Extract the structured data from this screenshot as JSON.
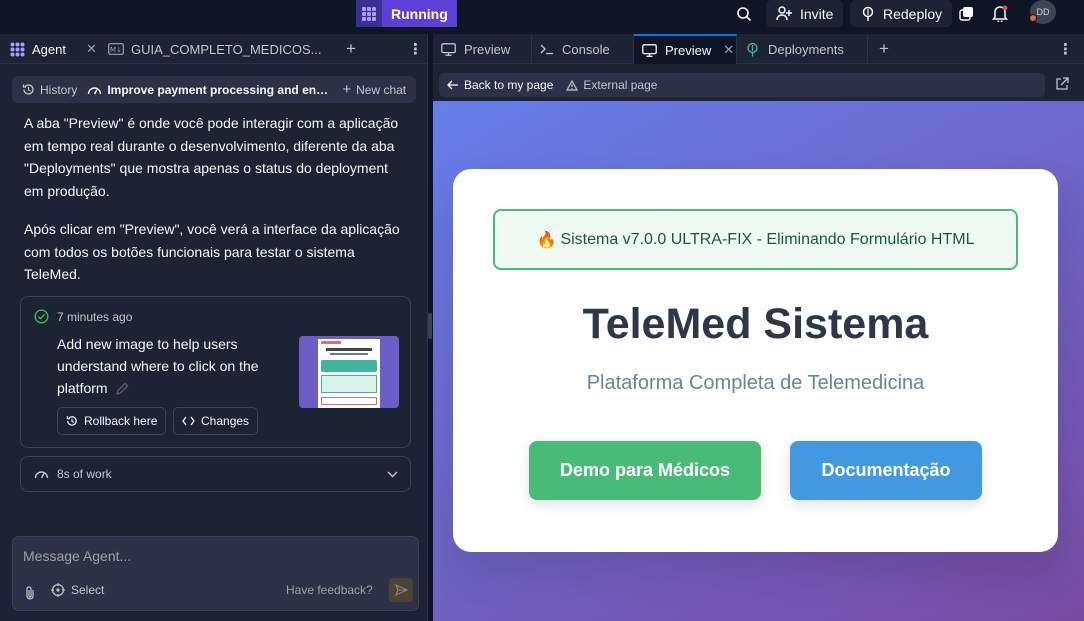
{
  "topbar": {
    "run_label": "Running",
    "invite_label": "Invite",
    "redeploy_label": "Redeploy",
    "avatar_initials": "DD"
  },
  "left_tabs": [
    {
      "label": "Agent",
      "icon": "agent-icon"
    },
    {
      "label": "GUIA_COMPLETO_MEDICOS...",
      "icon": "markdown-file-icon"
    }
  ],
  "history_bar": {
    "history_label": "History",
    "chat_title": "Improve payment processing and enab...",
    "new_chat_label": "New chat"
  },
  "messages": [
    "A aba \"Preview\" é onde você pode interagir com a aplicação em tempo real durante o desenvolvimento, diferente da aba \"Deployments\" que mostra apenas o status do deployment em produção.",
    "Após clicar em \"Preview\", você verá a interface da aplicação com todos os botões funcionais para testar o sistema TeleMed."
  ],
  "checkpoint": {
    "time": "7 minutes ago",
    "text": "Add new image to help users understand where to click on the platform",
    "rollback_label": "Rollback here",
    "changes_label": "Changes"
  },
  "work": {
    "label": "8s of work"
  },
  "composer": {
    "placeholder": "Message Agent...",
    "select_label": "Select",
    "feedback_label": "Have feedback?"
  },
  "right_tabs": [
    {
      "label": "Preview",
      "icon": "monitor-icon",
      "active": false
    },
    {
      "label": "Console",
      "icon": "terminal-icon",
      "active": false
    },
    {
      "label": "Preview",
      "icon": "monitor-icon",
      "active": true
    },
    {
      "label": "Deployments",
      "icon": "deploy-icon",
      "active": false
    }
  ],
  "url_bar": {
    "back_label": "Back to my page",
    "external_label": "External page"
  },
  "app": {
    "banner_emoji": "🔥",
    "banner": "Sistema v7.0.0 ULTRA-FIX - Eliminando Formulário HTML",
    "title": "TeleMed Sistema",
    "subtitle": "Plataforma Completa de Telemedicina",
    "btn_demo": "Demo para Médicos",
    "btn_docs": "Documentação"
  },
  "colors": {
    "running": "#5b3fd6",
    "gradient_start": "#667eea",
    "gradient_end": "#764ba2",
    "demo_button": "#48bb78",
    "docs_button": "#4299e1",
    "banner_border": "#48bb78"
  }
}
